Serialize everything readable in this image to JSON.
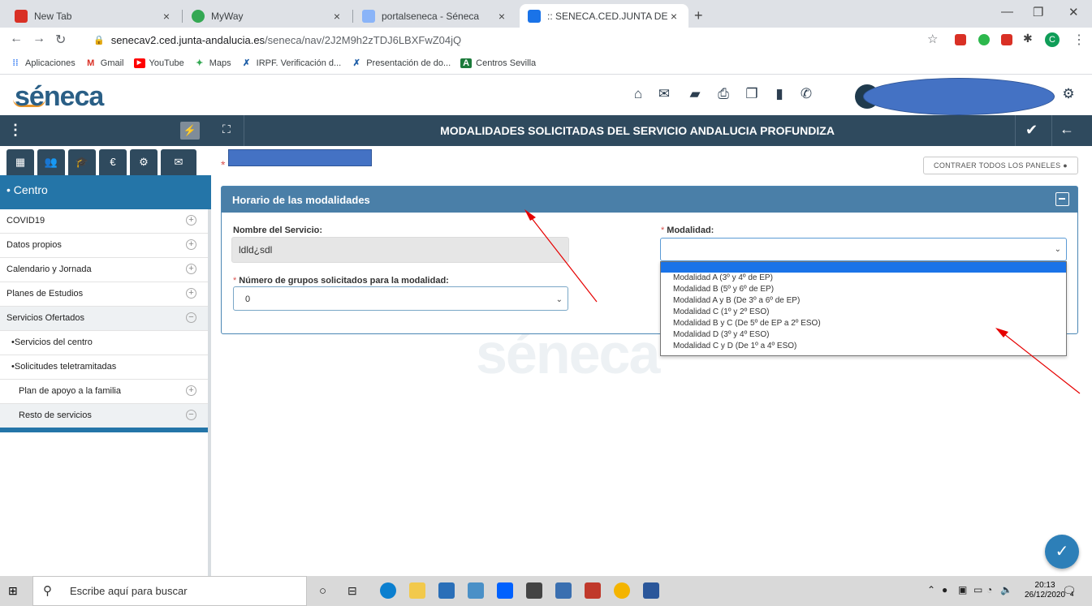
{
  "browser": {
    "tabs": [
      {
        "title": "New Tab",
        "favicon_color": "#d93025"
      },
      {
        "title": "MyWay",
        "favicon_color": "#34a853"
      },
      {
        "title": "portalseneca - Séneca",
        "favicon_color": "#8ab4f8"
      },
      {
        "title": ":: SENECA.CED.JUNTA DE ANDALU",
        "favicon_color": "#1a73e8"
      }
    ],
    "new_tab": "+",
    "url_domain": "senecav2.ced.junta-andalucia.es",
    "url_path": "/seneca/nav/2J2M9h2zTDJ6LBXFwZ04jQ",
    "profile_initial": "C"
  },
  "bookmarks": [
    {
      "label": "Aplicaciones",
      "icon": "apps-icon"
    },
    {
      "label": "Gmail",
      "icon": "gmail-icon"
    },
    {
      "label": "YouTube",
      "icon": "youtube-icon"
    },
    {
      "label": "Maps",
      "icon": "maps-icon"
    },
    {
      "label": "IRPF. Verificación d...",
      "icon": "irpf-icon"
    },
    {
      "label": "Presentación de do...",
      "icon": "presentacion-icon"
    },
    {
      "label": "Centros Sevilla",
      "icon": "andalucia-icon"
    }
  ],
  "app": {
    "logo": "séneca",
    "title": "MODALIDADES SOLICITADAS DEL SERVICIO ANDALUCIA PROFUNDIZA",
    "header_icons": [
      "home-icon",
      "mail-icon",
      "folder-icon",
      "print-icon",
      "documents-icon",
      "thumbs-icon",
      "phone-icon"
    ],
    "collapse_button": "CONTRAER TODOS LOS PANELES"
  },
  "sidebar": {
    "icons": [
      "building-icon",
      "users-icon",
      "graduation-icon",
      "euro-icon",
      "cogs-icon",
      "envelope-icon"
    ],
    "header": "• Centro",
    "items": [
      {
        "label": "COVID19",
        "control": "+"
      },
      {
        "label": "Datos propios",
        "control": "+"
      },
      {
        "label": "Calendario y Jornada",
        "control": "+"
      },
      {
        "label": "Planes de Estudios",
        "control": "+"
      },
      {
        "label": "Servicios Ofertados",
        "control": "−"
      },
      {
        "label": "•Servicios del centro",
        "control": ""
      },
      {
        "label": "•Solicitudes teletramitadas",
        "control": ""
      },
      {
        "label": "Plan de apoyo a la familia",
        "control": "+"
      },
      {
        "label": "Resto de servicios",
        "control": "−"
      }
    ]
  },
  "panel": {
    "title": "Horario de las modalidades",
    "service_name_label": "Nombre del Servicio:",
    "service_name_value": "ldld¿sdl",
    "groups_label": "Número de grupos solicitados para la modalidad:",
    "groups_value": "0",
    "modality_label": "Modalidad:",
    "modality_value": "",
    "modality_options": [
      "Modalidad A (3º y 4º de EP)",
      "Modalidad B (5º y 6º de EP)",
      "Modalidad A y B (De 3º a 6º de EP)",
      "Modalidad C (1º y 2º ESO)",
      "Modalidad B y C (De 5º de EP a 2º ESO)",
      "Modalidad D (3º y 4º ESO)",
      "Modalidad C y D (De 1º a 4º ESO)"
    ]
  },
  "watermark": "séneca",
  "taskbar": {
    "search_placeholder": "Escribe aquí para buscar",
    "time": "20:13",
    "date": "26/12/2020",
    "notifications": "4"
  },
  "colors": {
    "header_bar": "#2f4a5e",
    "accent_blue": "#2475a8",
    "panel_head": "#4a7fa8",
    "redaction": "#4472c4",
    "annotation_arrow": "#e60000"
  }
}
